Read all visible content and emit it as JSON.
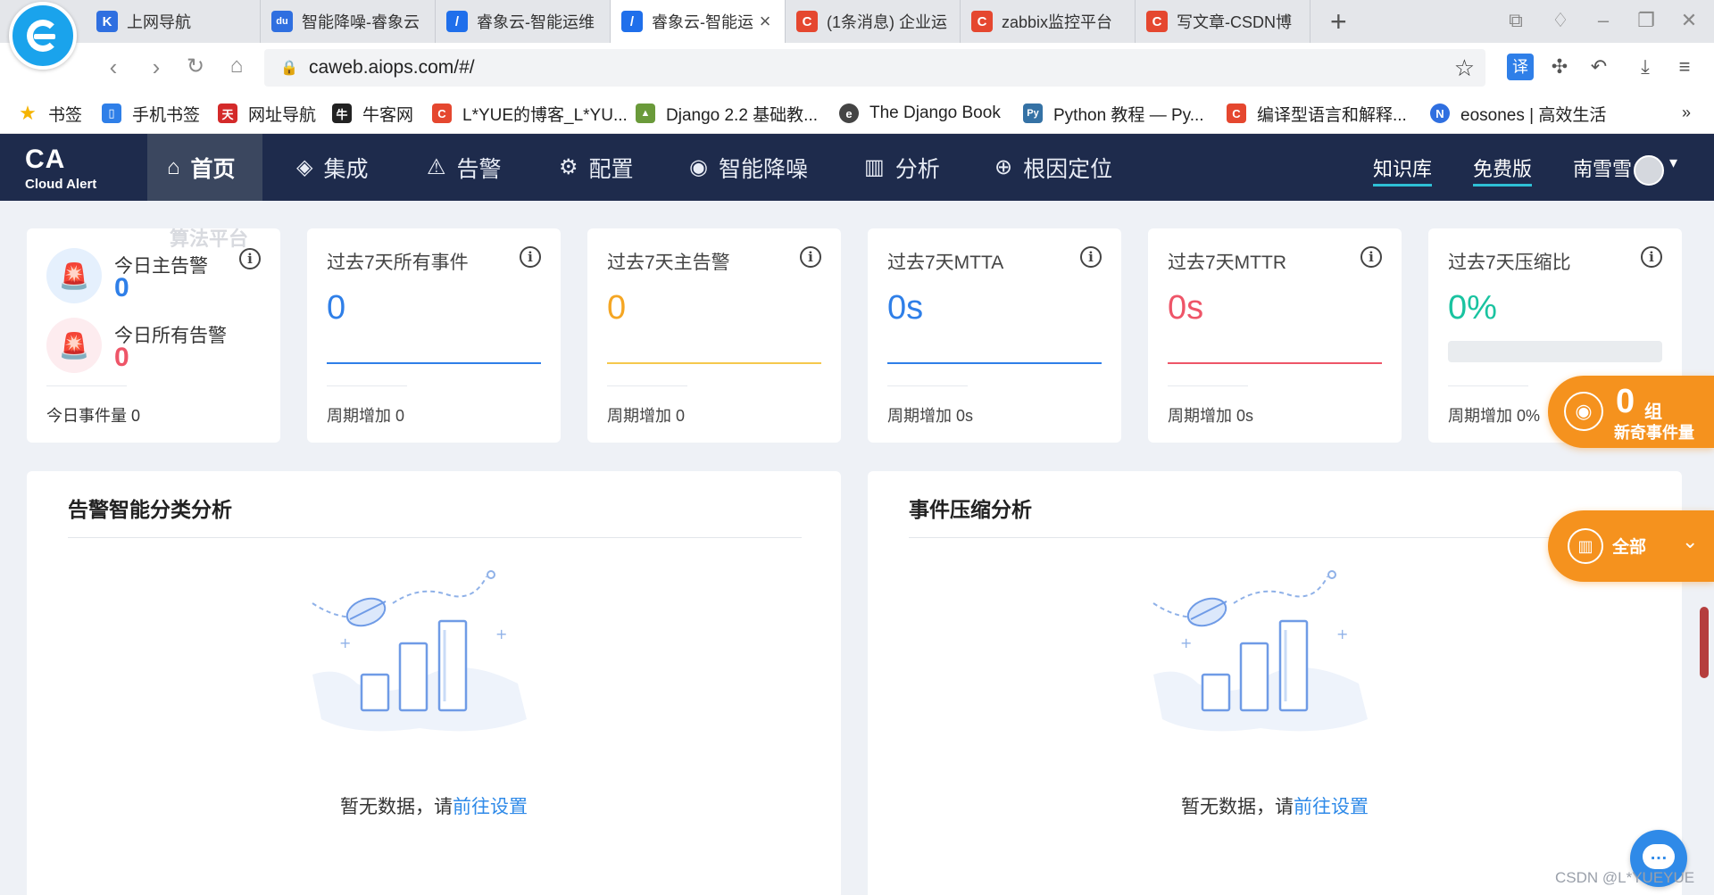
{
  "browser": {
    "tabs": [
      {
        "label": "上网导航",
        "favicon_color": "#2f6fe0",
        "favicon_text": "K",
        "active": false
      },
      {
        "label": "智能降噪-睿象云",
        "favicon_color": "#2f6fe0",
        "favicon_text": "du",
        "active": false
      },
      {
        "label": "睿象云-智能运维",
        "favicon_color": "#1f6feb",
        "favicon_text": "/",
        "active": false
      },
      {
        "label": "睿象云-智能运",
        "favicon_color": "#1f6feb",
        "favicon_text": "/",
        "active": true
      },
      {
        "label": "(1条消息) 企业运",
        "favicon_color": "#e5472f",
        "favicon_text": "C",
        "active": false
      },
      {
        "label": "zabbix监控平台",
        "favicon_color": "#e5472f",
        "favicon_text": "C",
        "active": false
      },
      {
        "label": "写文章-CSDN博",
        "favicon_color": "#e5472f",
        "favicon_text": "C",
        "active": false
      }
    ],
    "tab_close_glyph": "×",
    "new_tab_glyph": "+",
    "url": "caweb.aiops.com/#/",
    "translate_label": "译",
    "bookmarks": [
      {
        "label": "书签",
        "icon_color": "#f5b400",
        "icon_text": "★"
      },
      {
        "label": "手机书签",
        "icon_color": "#2f7fe8",
        "icon_text": "▯"
      },
      {
        "label": "网址导航",
        "icon_color": "#d42a2a",
        "icon_text": "天"
      },
      {
        "label": "牛客网",
        "icon_color": "#222222",
        "icon_text": "牛"
      },
      {
        "label": "L*YUE的博客_L*YU...",
        "icon_color": "#e5472f",
        "icon_text": "C"
      },
      {
        "label": "Django 2.2 基础教...",
        "icon_color": "#6a9a3a",
        "icon_text": "▲"
      },
      {
        "label": "The Django Book",
        "icon_color": "#444444",
        "icon_text": "e"
      },
      {
        "label": "Python 教程 — Py...",
        "icon_color": "#3572a5",
        "icon_text": "Py"
      },
      {
        "label": "编译型语言和解释...",
        "icon_color": "#e5472f",
        "icon_text": "C"
      },
      {
        "label": "eosones | 高效生活",
        "icon_color": "#2f6fe0",
        "icon_text": "N"
      }
    ],
    "bookmarks_more": "»"
  },
  "app": {
    "brand_ca": "CA",
    "brand_sub": "Cloud Alert",
    "nav": [
      {
        "label": "首页",
        "icon": "home-icon",
        "glyph": "⌂",
        "active": true
      },
      {
        "label": "集成",
        "icon": "layers-icon",
        "glyph": "◈",
        "active": false
      },
      {
        "label": "告警",
        "icon": "alarm-icon",
        "glyph": "⚠",
        "active": false
      },
      {
        "label": "配置",
        "icon": "gear-icon",
        "glyph": "⚙",
        "active": false
      },
      {
        "label": "智能降噪",
        "icon": "noise-icon",
        "glyph": "◉",
        "active": false
      },
      {
        "label": "分析",
        "icon": "chart-icon",
        "glyph": "▥",
        "active": false
      },
      {
        "label": "根因定位",
        "icon": "target-icon",
        "glyph": "⊕",
        "active": false
      }
    ],
    "links": {
      "knowledge": "知识库",
      "free": "免费版"
    },
    "user_name": "南雪雪"
  },
  "today": {
    "main_alert_label": "今日主告警",
    "main_alert_value": "0",
    "all_alert_label": "今日所有告警",
    "all_alert_value": "0",
    "events_label": "今日事件量 0",
    "watermark": "算法平台"
  },
  "stats": [
    {
      "title": "过去7天所有事件",
      "value": "0",
      "color": "#2f7fe8",
      "footer": "周期增加 0"
    },
    {
      "title": "过去7天主告警",
      "value": "0",
      "color": "#f5a623",
      "footer": "周期增加 0"
    },
    {
      "title": "过去7天MTTA",
      "value": "0s",
      "color": "#2f7fe8",
      "footer": "周期增加 0s"
    },
    {
      "title": "过去7天MTTR",
      "value": "0s",
      "color": "#ee5568",
      "footer": "周期增加 0s"
    },
    {
      "title": "过去7天压缩比",
      "value": "0%",
      "color": "#19c3a0",
      "footer": "周期增加 0%",
      "progress": 0
    }
  ],
  "info_glyph": "i",
  "panels": [
    {
      "title": "告警智能分类分析",
      "empty_text": "暂无数据，请",
      "link": "前往设置"
    },
    {
      "title": "事件压缩分析",
      "empty_text": "暂无数据，请",
      "link": "前往设置"
    }
  ],
  "float": {
    "count": "0",
    "unit": "组",
    "sub": "新奇事件量",
    "all_label": "全部"
  },
  "watermark_csdn": "CSDN @L*YUEYUE"
}
